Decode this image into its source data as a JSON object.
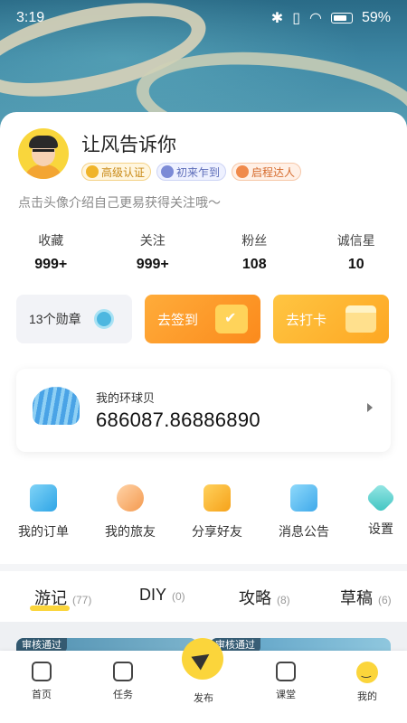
{
  "status_bar": {
    "time": "3:19",
    "battery": "59%"
  },
  "profile": {
    "username": "让风告诉你",
    "badges": [
      "高级认证",
      "初来乍到",
      "启程达人"
    ],
    "bio": "点击头像介绍自己更易获得关注哦～"
  },
  "stats": [
    {
      "label": "收藏",
      "value": "999+"
    },
    {
      "label": "关注",
      "value": "999+"
    },
    {
      "label": "粉丝",
      "value": "108"
    },
    {
      "label": "诚信星",
      "value": "10"
    }
  ],
  "actions": {
    "medals": "13个勋章",
    "sign_in": "去签到",
    "check_in": "去打卡"
  },
  "shell": {
    "label": "我的环球贝",
    "value": "686087.86886890"
  },
  "menu": [
    {
      "label": "我的订单",
      "icon": "order-icon"
    },
    {
      "label": "我的旅友",
      "icon": "friends-icon"
    },
    {
      "label": "分享好友",
      "icon": "share-icon"
    },
    {
      "label": "消息公告",
      "icon": "notice-icon"
    },
    {
      "label": "设置",
      "icon": "settings-icon"
    }
  ],
  "tabs": [
    {
      "name": "游记",
      "count": "(77)",
      "active": true
    },
    {
      "name": "DIY",
      "count": "(0)"
    },
    {
      "name": "攻略",
      "count": "(8)"
    },
    {
      "name": "草稿",
      "count": "(6)"
    }
  ],
  "preview": {
    "tag1": "审核通过",
    "tag2": "审核通过"
  },
  "bottom_nav": [
    {
      "label": "首页",
      "icon": "home-icon"
    },
    {
      "label": "任务",
      "icon": "task-icon"
    },
    {
      "label": "发布",
      "icon": "publish-icon"
    },
    {
      "label": "课堂",
      "icon": "classroom-icon"
    },
    {
      "label": "我的",
      "icon": "mine-icon"
    }
  ],
  "colors": {
    "accent": "#fbd53b",
    "sign_in": "#fb8a1c",
    "check_in": "#fda723"
  }
}
